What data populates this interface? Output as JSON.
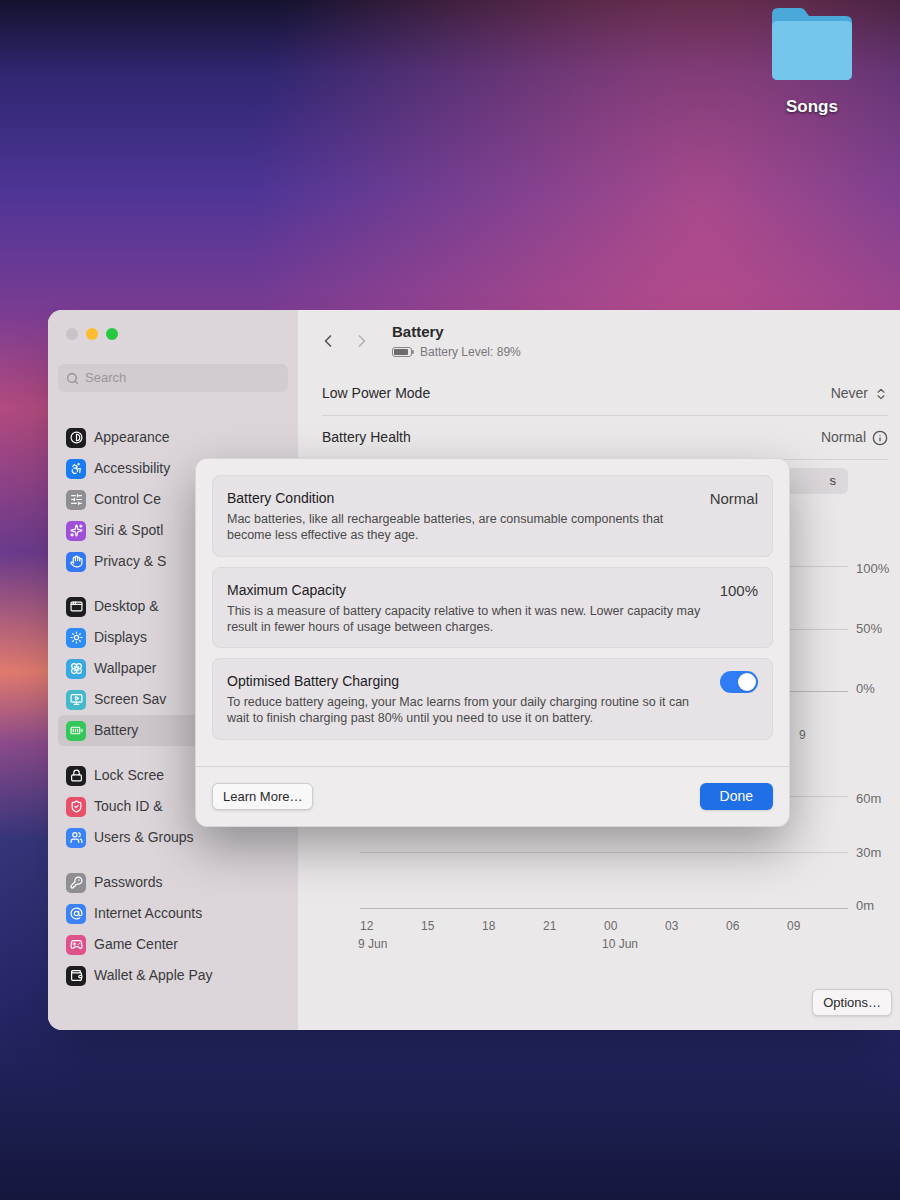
{
  "desktop": {
    "folders": [
      {
        "label": "Songs"
      }
    ]
  },
  "window": {
    "title": "Battery",
    "subtitle": "Battery Level: 89%",
    "battery_level": 0.89
  },
  "sidebar": {
    "search": {
      "placeholder": "Search"
    },
    "groups": [
      [
        {
          "label": "Appearance",
          "selected": false,
          "color": "#1d1d1f"
        },
        {
          "label": "Accessibility",
          "selected": false,
          "color": "#1a7cf5"
        },
        {
          "label": "Control Ce",
          "selected": false,
          "color": "#8e8e93"
        },
        {
          "label": "Siri & Spotl",
          "selected": false,
          "color": "#a050d8"
        },
        {
          "label": "Privacy & S",
          "selected": false,
          "color": "#3478f6"
        }
      ],
      [
        {
          "label": "Desktop &",
          "selected": false,
          "color": "#1d1d1f"
        },
        {
          "label": "Displays",
          "selected": false,
          "color": "#2f8cf5"
        },
        {
          "label": "Wallpaper",
          "selected": false,
          "color": "#3aa8e0"
        },
        {
          "label": "Screen Sav",
          "selected": false,
          "color": "#44b9c9"
        },
        {
          "label": "Battery",
          "selected": true,
          "color": "#34c759"
        }
      ],
      [
        {
          "label": "Lock Scree",
          "selected": false,
          "color": "#1d1d1f"
        },
        {
          "label": "Touch ID &",
          "selected": false,
          "color": "#e8506a"
        },
        {
          "label": "Users & Groups",
          "selected": false,
          "color": "#3b82f6"
        }
      ],
      [
        {
          "label": "Passwords",
          "selected": false,
          "color": "#8e8e93"
        },
        {
          "label": "Internet Accounts",
          "selected": false,
          "color": "#3b82f6"
        },
        {
          "label": "Game Center",
          "selected": false,
          "color": "#e0508a"
        },
        {
          "label": "Wallet & Apple Pay",
          "selected": false,
          "color": "#1d1d1f"
        }
      ]
    ]
  },
  "settings": [
    {
      "label": "Low Power Mode",
      "value": "Never",
      "kind": "popup"
    },
    {
      "label": "Battery Health",
      "value": "Normal",
      "kind": "info"
    }
  ],
  "chart_range": {
    "label_fragment": "s"
  },
  "level_chart": {
    "y_ticks": [
      "100%",
      "50%",
      "0%"
    ],
    "x_label_fragment": "9"
  },
  "usage_chart": {
    "y_ticks": [
      "60m",
      "30m",
      "0m"
    ],
    "x_ticks": [
      {
        "time": "12",
        "date": "9 Jun"
      },
      {
        "time": "15"
      },
      {
        "time": "18"
      },
      {
        "time": "21"
      },
      {
        "time": "00",
        "date": "10 Jun"
      },
      {
        "time": "03"
      },
      {
        "time": "06"
      },
      {
        "time": "09"
      }
    ]
  },
  "options_button": "Options…",
  "dialog": {
    "rows": [
      {
        "title": "Battery Condition",
        "description": "Mac batteries, like all rechargeable batteries, are consumable components that become less effective as they age.",
        "kind": "value",
        "value": "Normal"
      },
      {
        "title": "Maximum Capacity",
        "description": "This is a measure of battery capacity relative to when it was new. Lower capacity may result in fewer hours of usage between charges.",
        "kind": "value",
        "value": "100%"
      },
      {
        "title": "Optimised Battery Charging",
        "description": "To reduce battery ageing, your Mac learns from your daily charging routine so it can wait to finish charging past 80% until you need to use it on battery.",
        "kind": "toggle",
        "on": true
      }
    ],
    "buttons": [
      {
        "label": "Learn More…",
        "default": false
      },
      {
        "label": "Done",
        "default": true
      }
    ]
  }
}
